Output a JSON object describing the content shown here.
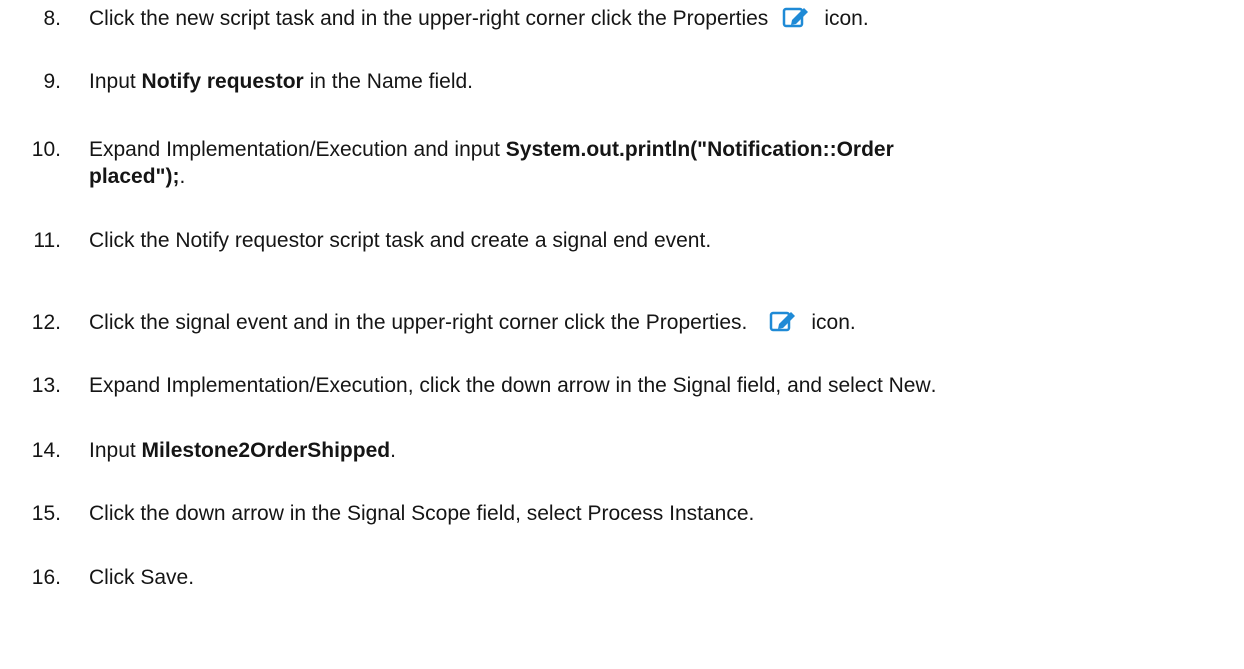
{
  "steps": [
    {
      "num": "8.",
      "parts": [
        "Click the new script task and in the upper-right corner click the ",
        "Properties",
        "icon."
      ]
    },
    {
      "num": "9.",
      "parts": [
        "Input ",
        "Notify requestor",
        " in the ",
        "Name",
        " field."
      ]
    },
    {
      "num": "10.",
      "parts": [
        "Expand ",
        "Implementation/Execution",
        " and input ",
        "System.out.println(\"Notification::Order",
        "placed\");",
        "."
      ]
    },
    {
      "num": "11.",
      "parts": [
        "Click the ",
        "Notify requestor",
        " script task and create a signal end event."
      ]
    },
    {
      "num": "12.",
      "parts": [
        "Click the signal event and in the upper-right corner click the ",
        "Properties",
        ".",
        "icon."
      ]
    },
    {
      "num": "13.",
      "parts": [
        "Expand ",
        "Implementation/Execution",
        ", click the down arrow in the ",
        "Signal",
        " field, and select ",
        "New",
        "."
      ]
    },
    {
      "num": "14.",
      "parts": [
        "Input ",
        "Milestone2OrderShipped",
        "."
      ]
    },
    {
      "num": "15.",
      "parts": [
        "Click the down arrow in the ",
        "Signal Scope",
        " field, select ",
        "Process Instance",
        "."
      ]
    },
    {
      "num": "16.",
      "parts": [
        "Click ",
        "Save",
        "."
      ]
    }
  ],
  "icons": {
    "properties": "properties-edit-icon",
    "color": "#1f8ad6"
  }
}
